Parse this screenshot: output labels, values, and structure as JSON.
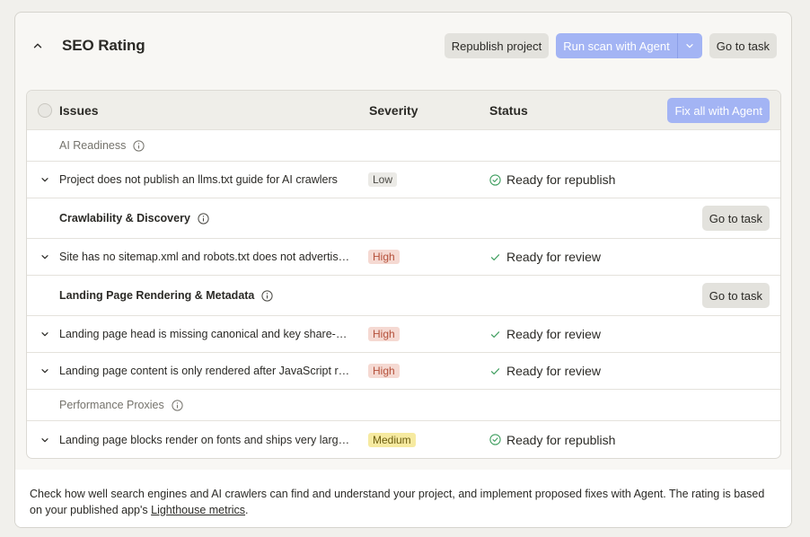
{
  "header": {
    "title": "SEO Rating",
    "republish_label": "Republish project",
    "run_scan_label": "Run scan with Agent",
    "go_to_task_label": "Go to task"
  },
  "table": {
    "col_issues": "Issues",
    "col_severity": "Severity",
    "col_status": "Status",
    "fix_all_label": "Fix all with Agent"
  },
  "groups": [
    {
      "label": "AI Readiness"
    },
    {
      "label": "Crawlability & Discovery",
      "action_label": "Go to task"
    },
    {
      "label": "Landing Page Rendering & Metadata",
      "action_label": "Go to task"
    },
    {
      "label": "Performance Proxies"
    }
  ],
  "issues": [
    {
      "text": "Project does not publish an llms.txt guide for AI crawlers",
      "severity": "Low",
      "status": "Ready for republish"
    },
    {
      "text": "Site has no sitemap.xml and robots.txt does not advertise it",
      "severity": "High",
      "status": "Ready for review"
    },
    {
      "text": "Landing page head is missing canonical and key share-preview tags",
      "severity": "High",
      "status": "Ready for review"
    },
    {
      "text": "Landing page content is only rendered after JavaScript runs",
      "severity": "High",
      "status": "Ready for review"
    },
    {
      "text": "Landing page blocks render on fonts and ships very large assets",
      "severity": "Medium",
      "status": "Ready for republish"
    }
  ],
  "footer": {
    "text": "Check how well search engines and AI crawlers can find and understand your project, and implement proposed fixes with Agent. The rating is based on your published app's ",
    "link": "Lighthouse metrics",
    "end": "."
  },
  "colors": {
    "accent": "#a3b4f4",
    "success": "#3f9e5f",
    "high": "#f5d9d2",
    "medium": "#f6eaa0"
  },
  "icons": {
    "collapse": "chevron-up-icon",
    "expand": "chevron-down-icon",
    "info": "info-icon",
    "republish_status": "check-circle-icon",
    "review_status": "check-icon"
  }
}
